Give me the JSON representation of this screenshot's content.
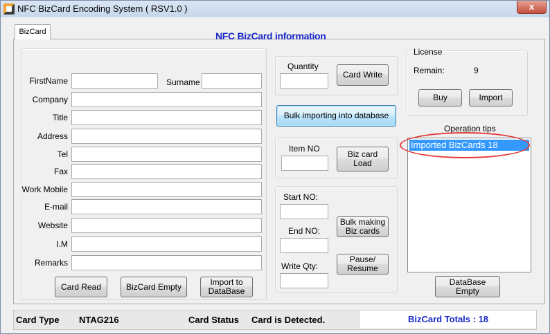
{
  "window": {
    "title": "NFC BizCard Encoding System ( RSV1.0 )",
    "close_glyph": "x"
  },
  "tab": {
    "label": "BizCard"
  },
  "header": {
    "title": "NFC BizCard information"
  },
  "form": {
    "firstname_label": "FirstName",
    "surname_label": "Surname",
    "company_label": "Company",
    "title_label": "Title",
    "address_label": "Address",
    "tel_label": "Tel",
    "fax_label": "Fax",
    "work_mobile_label": "Work Mobile",
    "email_label": "E-mail",
    "website_label": "Website",
    "im_label": "I.M",
    "remarks_label": "Remarks",
    "values": {
      "firstname": "",
      "surname": "",
      "company": "",
      "title": "",
      "address": "",
      "tel": "",
      "fax": "",
      "work_mobile": "",
      "email": "",
      "website": "",
      "im": "",
      "remarks": ""
    },
    "card_read_label": "Card Read",
    "bizcard_empty_label": "BizCard Empty",
    "import_db_label": "Import to DataBase"
  },
  "write": {
    "quantity_label": "Quantity",
    "quantity_value": "",
    "card_write_label": "Card Write",
    "bulk_import_label": "Bulk importing into database"
  },
  "load": {
    "item_no_label": "Item NO",
    "item_no_value": "",
    "biz_card_load_label": "Biz card Load"
  },
  "bulk": {
    "start_no_label": "Start NO:",
    "end_no_label": "End NO:",
    "write_qty_label": "Write Qty:",
    "start_no_value": "",
    "end_no_value": "",
    "write_qty_value": "",
    "bulk_making_label": "Bulk making Biz cards",
    "pause_resume_label": "Pause/ Resume"
  },
  "license": {
    "group_label": "License",
    "remain_label": "Remain:",
    "remain_value": "9",
    "buy_label": "Buy",
    "import_label": "Import"
  },
  "tips": {
    "label": "Operation tips",
    "items": [
      "Imported BizCards 18"
    ],
    "database_empty_label": "DataBase Empty"
  },
  "status": {
    "card_type_label": "Card Type",
    "card_type_value": "NTAG216",
    "card_status_label": "Card Status",
    "card_status_value": "Card is Detected.",
    "totals": "BizCard Totals : 18"
  },
  "colors": {
    "header_title": "#1a27c9",
    "selection": "#3399ff",
    "annotation_ellipse": "#e33b3b"
  }
}
